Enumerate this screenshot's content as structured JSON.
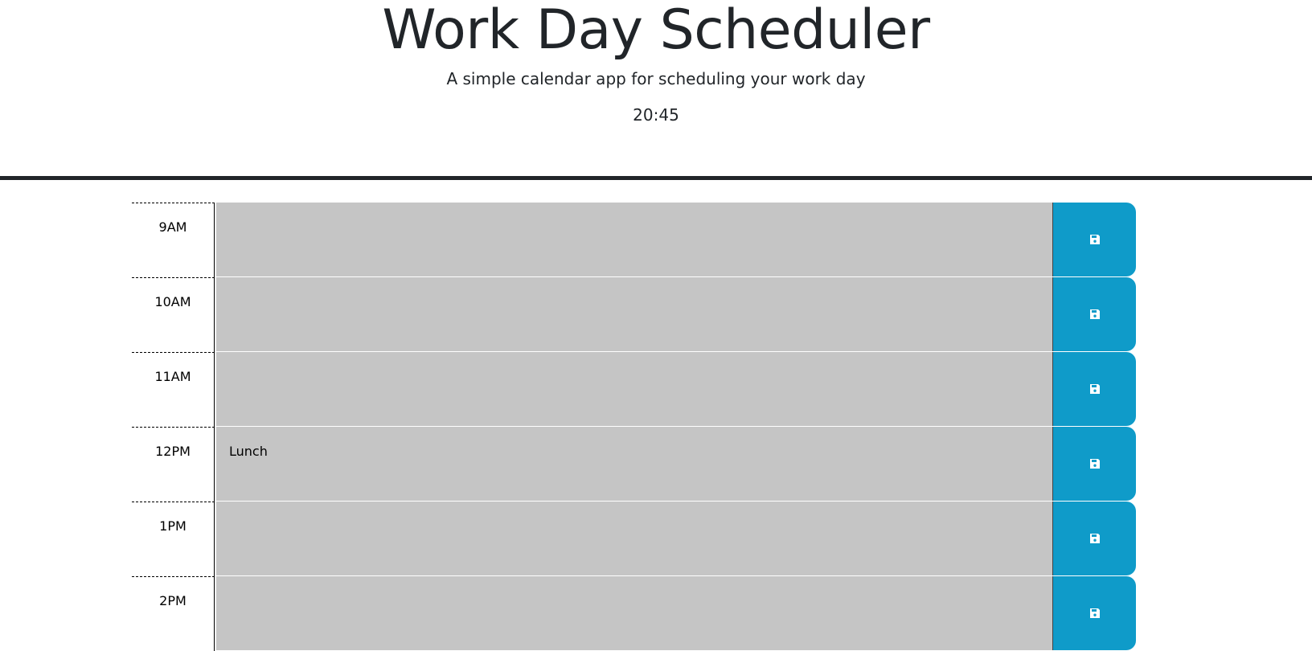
{
  "header": {
    "title": "Work Day Scheduler",
    "subtitle": "A simple calendar app for scheduling your work day",
    "current_time": "20:45"
  },
  "colors": {
    "past_block": "#c5c5c5",
    "save_button": "#0f9bc9",
    "header_rule": "#212529"
  },
  "time_blocks": [
    {
      "hour": "9AM",
      "task": "",
      "save_icon": "floppy-disk-icon"
    },
    {
      "hour": "10AM",
      "task": "",
      "save_icon": "floppy-disk-icon"
    },
    {
      "hour": "11AM",
      "task": "",
      "save_icon": "floppy-disk-icon"
    },
    {
      "hour": "12PM",
      "task": "Lunch",
      "save_icon": "floppy-disk-icon"
    },
    {
      "hour": "1PM",
      "task": "",
      "save_icon": "floppy-disk-icon"
    },
    {
      "hour": "2PM",
      "task": "",
      "save_icon": "floppy-disk-icon"
    }
  ]
}
